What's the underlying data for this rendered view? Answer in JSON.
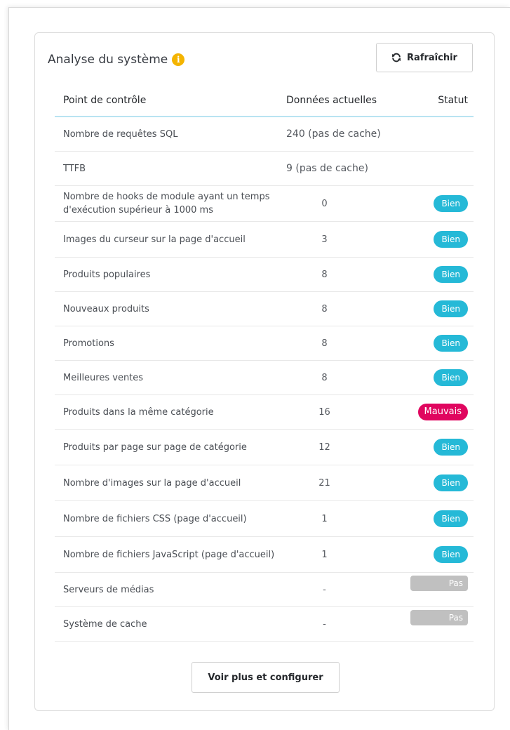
{
  "panel": {
    "title": "Analyse du système",
    "info_icon": "info-icon",
    "refresh_label": "Rafraîchir",
    "refresh_icon": "refresh-icon",
    "more_label": "Voir plus et configurer"
  },
  "table": {
    "headers": {
      "checkpoint": "Point de contrôle",
      "current": "Données actuelles",
      "status": "Statut"
    },
    "rows": [
      {
        "label": "Nombre de requêtes SQL",
        "value": "240 (pas de cache)",
        "status": ""
      },
      {
        "label": "TTFB",
        "value": "9 (pas de cache)",
        "status": ""
      },
      {
        "label": "Nombre de hooks de module ayant un temps d'exécution supérieur à 1000 ms",
        "value": "0",
        "status": "Bien"
      },
      {
        "label": "Images du curseur sur la page d'accueil",
        "value": "3",
        "status": "Bien"
      },
      {
        "label": "Produits populaires",
        "value": "8",
        "status": "Bien"
      },
      {
        "label": "Nouveaux produits",
        "value": "8",
        "status": "Bien"
      },
      {
        "label": "Promotions",
        "value": "8",
        "status": "Bien"
      },
      {
        "label": "Meilleures ventes",
        "value": "8",
        "status": "Bien"
      },
      {
        "label": "Produits dans la même catégorie",
        "value": "16",
        "status": "Mauvais"
      },
      {
        "label": "Produits par page sur page de catégorie",
        "value": "12",
        "status": "Bien"
      },
      {
        "label": "Nombre d'images sur la page d'accueil",
        "value": "21",
        "status": "Bien"
      },
      {
        "label": "Nombre de fichiers CSS (page d'accueil)",
        "value": "1",
        "status": "Bien"
      },
      {
        "label": "Nombre de fichiers JavaScript (page d'accueil)",
        "value": "1",
        "status": "Bien"
      },
      {
        "label": "Serveurs de médias",
        "value": "-",
        "status": "Pas configuré"
      },
      {
        "label": "Système de cache",
        "value": "-",
        "status": "Pas configuré"
      }
    ]
  },
  "colors": {
    "good": "#25b9d7",
    "bad": "#e0065f",
    "not_configured": "#c0c0c0",
    "info": "#f4b400"
  }
}
